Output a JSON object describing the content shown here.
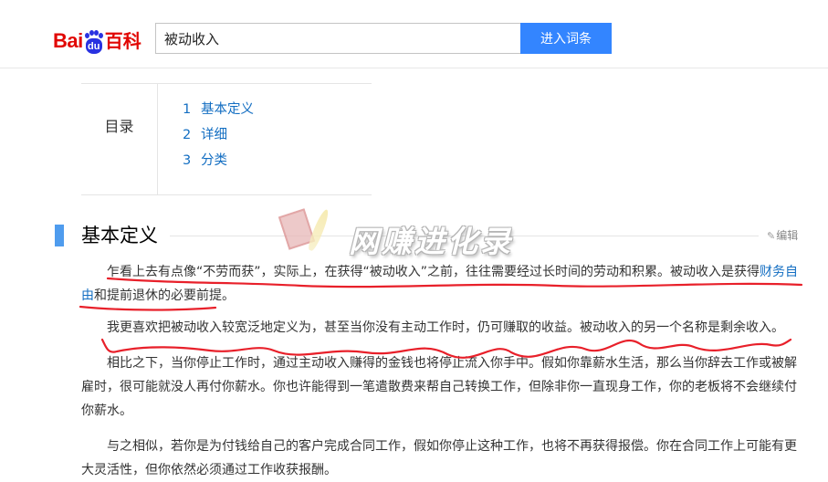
{
  "header": {
    "logo_prefix": "Bai",
    "logo_paw_text": "du",
    "logo_suffix": "百科",
    "search_value": "被动收入",
    "search_button": "进入词条"
  },
  "toc": {
    "title": "目录",
    "items": [
      {
        "num": "1",
        "label": "基本定义"
      },
      {
        "num": "2",
        "label": "详细"
      },
      {
        "num": "3",
        "label": "分类"
      }
    ]
  },
  "section": {
    "title": "基本定义",
    "edit_label": "编辑"
  },
  "watermark": {
    "text": "网赚进化录"
  },
  "paragraphs": {
    "p1_before_link": "乍看上去有点像“不劳而获”，实际上，在获得“被动收入”之前，往往需要经过长时间的劳动和积累。被动收入是获得",
    "p1_link": "财务自由",
    "p1_after_link": "和提前退休的必要前提。",
    "p2": "我更喜欢把被动收入较宽泛地定义为，甚至当你没有主动工作时，仍可赚取的收益。被动收入的另一个名称是剩余收入。",
    "p3": "相比之下，当你停止工作时，通过主动收入赚得的金钱也将停止流入你手中。假如你靠薪水生活，那么当你辞去工作或被解雇时，很可能就没人再付你薪水。你也许能得到一笔遣散费来帮自己转换工作，但除非你一直现身工作，你的老板将不会继续付你薪水。",
    "p4": "与之相似，若你是为付钱给自己的客户完成合同工作，假如你停止这种工作，也将不再获得报偿。你在合同工作上可能有更大灵活性，但你依然必须通过工作收获报酬。"
  },
  "colors": {
    "baidu_red": "#e10602",
    "baidu_blue": "#2932e1",
    "button_blue": "#3385ff",
    "link_blue": "#136ec2",
    "section_bar": "#4f9cee",
    "annotation_red": "#e8202a"
  }
}
